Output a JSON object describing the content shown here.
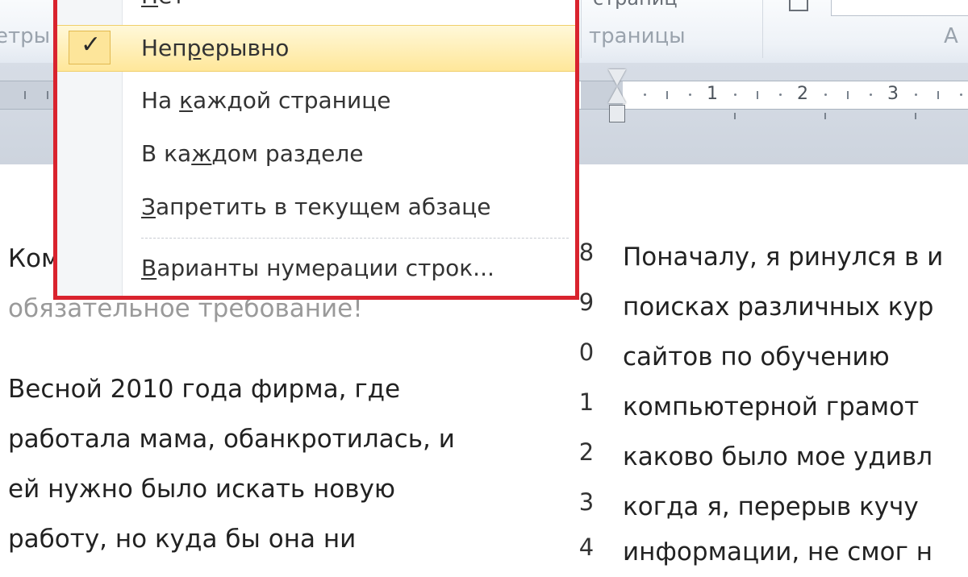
{
  "ribbon": {
    "group_params_label": "етры",
    "group_page_label": "траницы",
    "group_a_label": "А",
    "top_partial_text": "страниц"
  },
  "ruler": {
    "numbers": [
      "1",
      "2",
      "3"
    ]
  },
  "menu": {
    "items": [
      {
        "pre": "",
        "acc": "Н",
        "post": "ет",
        "checked": false
      },
      {
        "pre": "Неп",
        "acc": "р",
        "post": "ерывно",
        "checked": true
      },
      {
        "pre": "На ",
        "acc": "к",
        "post": "аждой странице",
        "checked": false
      },
      {
        "pre": "В ка",
        "acc": "ж",
        "post": "дом разделе",
        "checked": false
      },
      {
        "pre": "",
        "acc": "З",
        "post": "апретить в текущем абзаце",
        "checked": false
      },
      {
        "pre": "",
        "acc": "В",
        "post": "арианты нумерации строк...",
        "checked": false
      }
    ],
    "check_glyph": "✓"
  },
  "document": {
    "left_col": {
      "line1": "Ком",
      "line2": "обязательное требование!",
      "line3": "Весной 2010  года фирма, где",
      "line4": "работала мама, обанкротилась, и",
      "line5": "ей нужно было искать новую",
      "line6": "работу, но куда бы она ни"
    },
    "right_col": {
      "line_numbers": [
        "8",
        "9",
        "0",
        "1",
        "2",
        "3",
        "4"
      ],
      "lines": [
        "Поначалу, я ринулся в и",
        "поисках различных кур",
        "сайтов по обучению",
        "компьютерной грамот",
        "каково было мое удивл",
        "когда я, перерыв кучу",
        "информации, не смог н"
      ]
    }
  },
  "colors": {
    "highlight_border": "#d9232e",
    "selected_item": "#ffe79a"
  }
}
